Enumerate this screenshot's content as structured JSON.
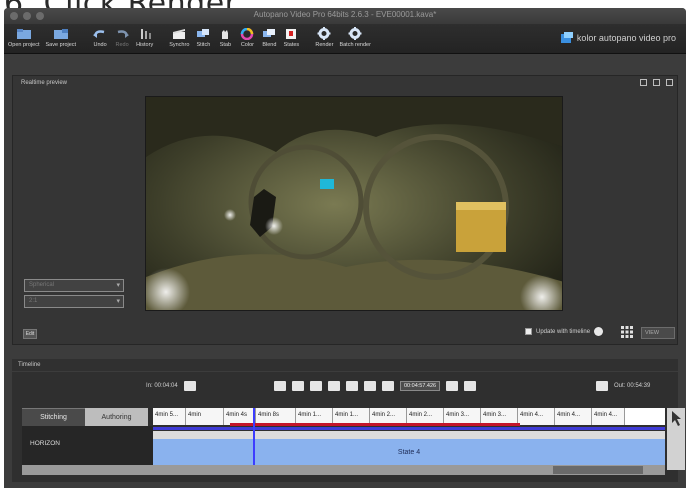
{
  "instruction": "6.  Click Render.",
  "window": {
    "title": "Autopano Video Pro 64bits 2.6.3 - EVE00001.kava*"
  },
  "toolbar": {
    "items": [
      {
        "label": "Open project",
        "icon": "open-project-icon"
      },
      {
        "label": "Save project",
        "icon": "save-project-icon"
      },
      {
        "label": "Undo",
        "icon": "undo-icon"
      },
      {
        "label": "Redo",
        "icon": "redo-icon",
        "disabled": true
      },
      {
        "label": "History",
        "icon": "history-icon"
      },
      {
        "label": "Synchro",
        "icon": "synchro-icon"
      },
      {
        "label": "Stitch",
        "icon": "stitch-icon"
      },
      {
        "label": "Stab",
        "icon": "stab-icon"
      },
      {
        "label": "Color",
        "icon": "color-icon"
      },
      {
        "label": "Blend",
        "icon": "blend-icon"
      },
      {
        "label": "States",
        "icon": "states-icon"
      },
      {
        "label": "Render",
        "icon": "render-gear-icon"
      },
      {
        "label": "Batch render",
        "icon": "batch-render-gear-icon"
      }
    ],
    "brand": "kolor autopano video pro"
  },
  "preview": {
    "title": "Realtime preview",
    "projection_select": "Spherical",
    "ratio_select": "2:1",
    "edit_label": "Edit",
    "update_label": "Update with timeline",
    "view_select": "VIEW"
  },
  "timeline": {
    "title": "Timeline",
    "in_time": "In: 00:04:04",
    "current_time": "00:04:57.426",
    "out_time": "Out: 00:54:39",
    "tabs": {
      "stitching": "Stitching",
      "authoring": "Authoring"
    },
    "horizon_label": "HORIZON",
    "clips": [
      "4min 5...",
      "4min",
      "4min 4s",
      "4min 8s",
      "4min 1...",
      "4min 1...",
      "4min 2...",
      "4min 2...",
      "4min 3...",
      "4min 3...",
      "4min 4...",
      "4min 4...",
      "4min 4..."
    ],
    "state_label": "State 4"
  },
  "colors": {
    "toolbar_bg": "#262626",
    "panel_bg": "#353535",
    "red_marker": "#c4152a",
    "playhead": "#3d3dff",
    "state_track": "#8ab2ee"
  }
}
